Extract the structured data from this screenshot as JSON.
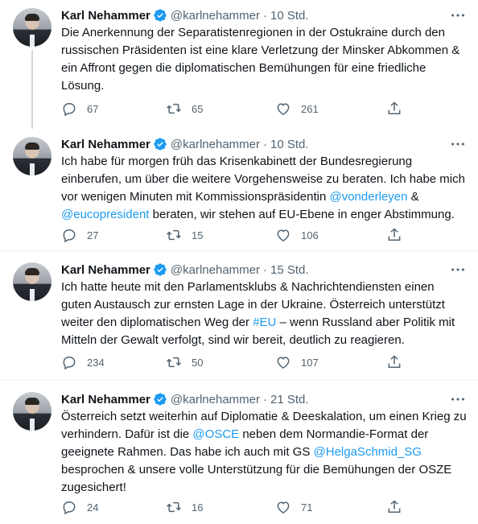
{
  "colors": {
    "accent": "#1d9bf0",
    "text": "#0f1419",
    "muted": "#536471",
    "border": "#eff3f4"
  },
  "icons": [
    "verified-badge-icon",
    "more-icon",
    "reply-icon",
    "retweet-icon",
    "like-icon",
    "share-icon"
  ],
  "tweets": [
    {
      "name": "Karl Nehammer",
      "handle": "@karlnehammer",
      "dot": "·",
      "time": "10 Std.",
      "text_parts": [
        "Die Anerkennung der Separatistenregionen in der Ostukraine durch den russischen Präsidenten ist eine klare Verletzung der Minsker Abkommen & ein Affront gegen die diplomatischen Bemühungen für eine friedliche Lösung."
      ],
      "replies": "67",
      "retweets": "65",
      "likes": "261"
    },
    {
      "name": "Karl Nehammer",
      "handle": "@karlnehammer",
      "dot": "·",
      "time": "10 Std.",
      "text_parts": [
        "Ich habe für morgen früh das Krisenkabinett der Bundesregierung einberufen, um über die weitere Vorgehensweise zu beraten. Ich habe mich vor wenigen Minuten mit Kommissionspräsidentin ",
        "@vonderleyen",
        " & ",
        "@eucopresident",
        " beraten, wir stehen auf EU-Ebene in enger Abstimmung."
      ],
      "replies": "27",
      "retweets": "15",
      "likes": "106"
    },
    {
      "name": "Karl Nehammer",
      "handle": "@karlnehammer",
      "dot": "·",
      "time": "15 Std.",
      "text_parts": [
        "Ich hatte heute mit den Parlamentsklubs & Nachrichtendiensten einen guten Austausch zur ernsten Lage in der Ukraine. Österreich unterstützt weiter den diplomatischen Weg der ",
        "#EU",
        " – wenn Russland aber Politik mit Mitteln der Gewalt verfolgt, sind wir bereit, deutlich zu reagieren."
      ],
      "replies": "234",
      "retweets": "50",
      "likes": "107"
    },
    {
      "name": "Karl Nehammer",
      "handle": "@karlnehammer",
      "dot": "·",
      "time": "21 Std.",
      "text_parts": [
        "Österreich setzt weiterhin auf Diplomatie & Deeskalation, um einen Krieg zu verhindern. Dafür ist die ",
        "@OSCE",
        " neben dem Normandie-Format der geeignete Rahmen. Das habe ich auch mit GS ",
        "@HelgaSchmid_SG",
        " besprochen & unsere volle Unterstützung für die Bemühungen der OSZE zugesichert!"
      ],
      "replies": "24",
      "retweets": "16",
      "likes": "71"
    }
  ]
}
